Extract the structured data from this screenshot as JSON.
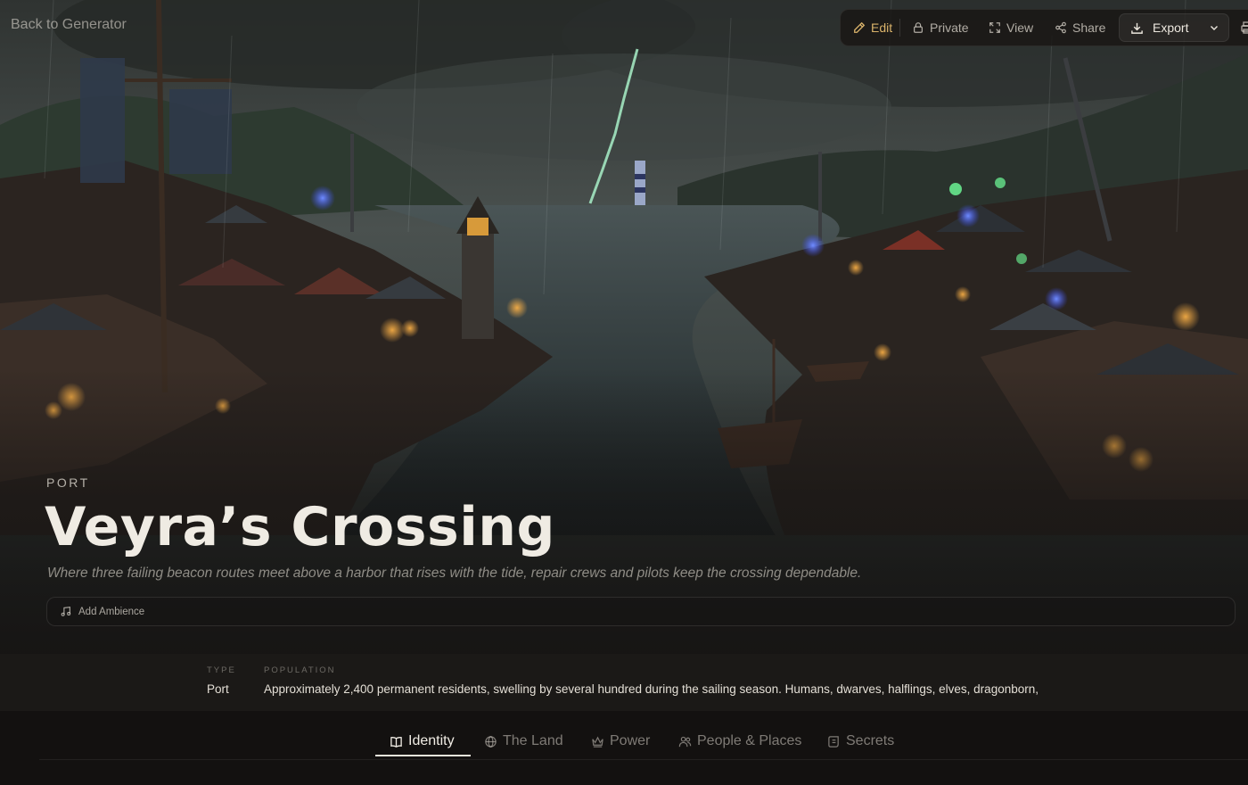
{
  "nav": {
    "back_label": "Back to Generator"
  },
  "toolbar": {
    "edit_label": "Edit",
    "private_label": "Private",
    "view_label": "View",
    "share_label": "Share",
    "export_label": "Export"
  },
  "hero": {
    "kind": "PORT",
    "title": "Veyra’s Crossing",
    "tagline": "Where three failing beacon routes meet above a harbor that rises with the tide, repair crews and pilots keep the crossing dependable.",
    "ambience_label": "Add Ambience"
  },
  "stats": {
    "type_label": "TYPE",
    "type_value": "Port",
    "population_label": "POPULATION",
    "population_value": "Approximately 2,400 permanent residents, swelling by several hundred during the sailing season. Humans, dwarves, halflings, elves, dragonborn,"
  },
  "tabs": [
    {
      "label": "Identity",
      "icon": "book-icon",
      "active": true
    },
    {
      "label": "The Land",
      "icon": "globe-icon",
      "active": false
    },
    {
      "label": "Power",
      "icon": "crown-icon",
      "active": false
    },
    {
      "label": "People & Places",
      "icon": "users-icon",
      "active": false
    },
    {
      "label": "Secrets",
      "icon": "scroll-icon",
      "active": false
    }
  ],
  "colors": {
    "accent": "#d9b26a",
    "background": "#141211",
    "text": "#efebe3"
  }
}
